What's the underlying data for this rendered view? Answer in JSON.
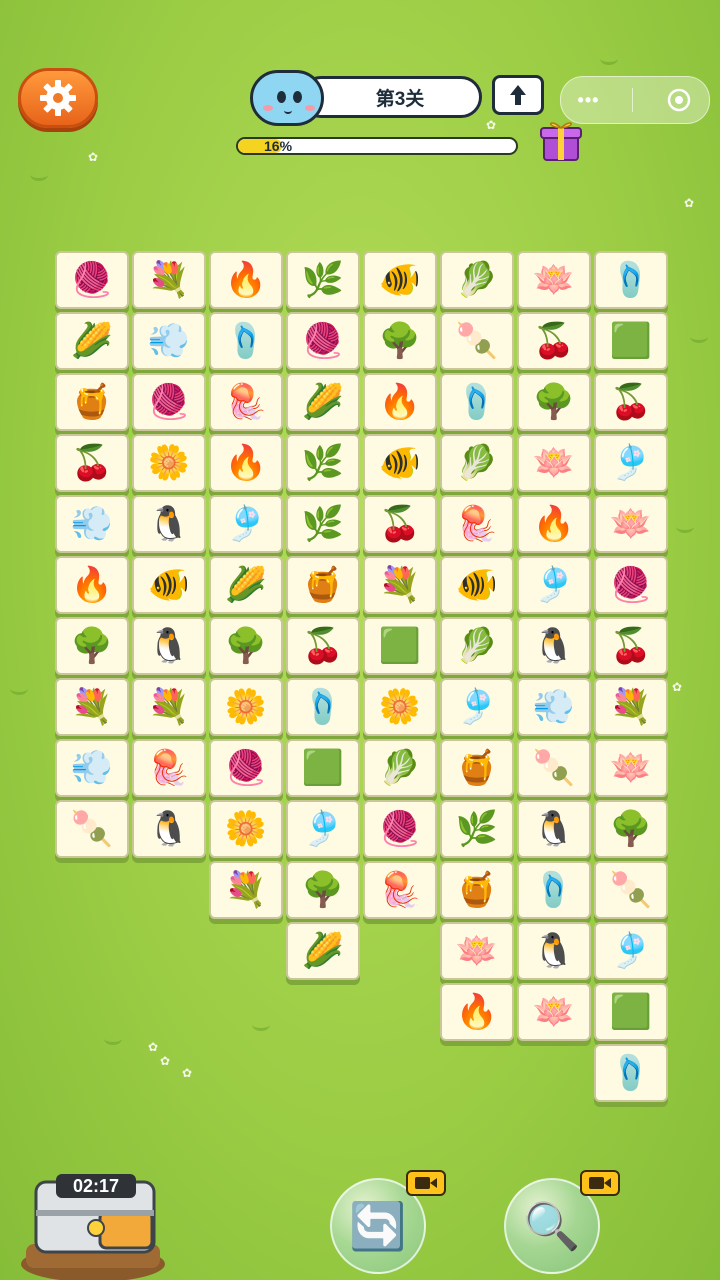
{
  "header": {
    "level_label": "第3关",
    "progress_label": "16%",
    "progress_value": 0.16,
    "menu_dots": "•••"
  },
  "timer": {
    "value": "02:17"
  },
  "colors": {
    "tile_bg": "#fffbe3",
    "tile_shadow": "#7fa83a",
    "settings_orange": "#f07a28",
    "progress_yellow": "#f5d321"
  },
  "board": {
    "tiles": [
      {
        "r": 0,
        "c": 0,
        "icon": "yarn-ball",
        "glyph": "🧶"
      },
      {
        "r": 0,
        "c": 1,
        "icon": "flower-pot",
        "glyph": "💐"
      },
      {
        "r": 0,
        "c": 2,
        "icon": "campfire",
        "glyph": "🔥"
      },
      {
        "r": 0,
        "c": 3,
        "icon": "monstera-leaf",
        "glyph": "🌿"
      },
      {
        "r": 0,
        "c": 4,
        "icon": "clownfish",
        "glyph": "🐠"
      },
      {
        "r": 0,
        "c": 5,
        "icon": "cabbage",
        "glyph": "🥬"
      },
      {
        "r": 0,
        "c": 6,
        "icon": "lotus",
        "glyph": "🪷"
      },
      {
        "r": 0,
        "c": 7,
        "icon": "flip-flops",
        "glyph": "🩴"
      },
      {
        "r": 1,
        "c": 0,
        "icon": "corn",
        "glyph": "🌽"
      },
      {
        "r": 1,
        "c": 1,
        "icon": "hair-dryer",
        "glyph": "💨"
      },
      {
        "r": 1,
        "c": 2,
        "icon": "flip-flops",
        "glyph": "🩴"
      },
      {
        "r": 1,
        "c": 3,
        "icon": "yarn-ball",
        "glyph": "🧶"
      },
      {
        "r": 1,
        "c": 4,
        "icon": "bonsai",
        "glyph": "🌳"
      },
      {
        "r": 1,
        "c": 5,
        "icon": "popsicle",
        "glyph": "🍡"
      },
      {
        "r": 1,
        "c": 6,
        "icon": "cherries",
        "glyph": "🍒"
      },
      {
        "r": 1,
        "c": 7,
        "icon": "towels",
        "glyph": "🟩"
      },
      {
        "r": 2,
        "c": 0,
        "icon": "honeycomb",
        "glyph": "🍯"
      },
      {
        "r": 2,
        "c": 1,
        "icon": "yarn-ball",
        "glyph": "🧶"
      },
      {
        "r": 2,
        "c": 2,
        "icon": "jellyfish",
        "glyph": "🪼"
      },
      {
        "r": 2,
        "c": 3,
        "icon": "corn",
        "glyph": "🌽"
      },
      {
        "r": 2,
        "c": 4,
        "icon": "campfire",
        "glyph": "🔥"
      },
      {
        "r": 2,
        "c": 5,
        "icon": "flip-flops",
        "glyph": "🩴"
      },
      {
        "r": 2,
        "c": 6,
        "icon": "bonsai",
        "glyph": "🌳"
      },
      {
        "r": 2,
        "c": 7,
        "icon": "cherries",
        "glyph": "🍒"
      },
      {
        "r": 3,
        "c": 0,
        "icon": "cherries",
        "glyph": "🍒"
      },
      {
        "r": 3,
        "c": 1,
        "icon": "yellow-flower",
        "glyph": "🌼"
      },
      {
        "r": 3,
        "c": 2,
        "icon": "campfire",
        "glyph": "🔥"
      },
      {
        "r": 3,
        "c": 3,
        "icon": "monstera-leaf",
        "glyph": "🌿"
      },
      {
        "r": 3,
        "c": 4,
        "icon": "clownfish",
        "glyph": "🐠"
      },
      {
        "r": 3,
        "c": 5,
        "icon": "cabbage",
        "glyph": "🥬"
      },
      {
        "r": 3,
        "c": 6,
        "icon": "lotus",
        "glyph": "🪷"
      },
      {
        "r": 3,
        "c": 7,
        "icon": "pinwheel",
        "glyph": "🎐"
      },
      {
        "r": 4,
        "c": 0,
        "icon": "hair-dryer",
        "glyph": "💨"
      },
      {
        "r": 4,
        "c": 1,
        "icon": "penguin",
        "glyph": "🐧"
      },
      {
        "r": 4,
        "c": 2,
        "icon": "pinwheel",
        "glyph": "🎐"
      },
      {
        "r": 4,
        "c": 3,
        "icon": "monstera-leaf",
        "glyph": "🌿"
      },
      {
        "r": 4,
        "c": 4,
        "icon": "cherries",
        "glyph": "🍒"
      },
      {
        "r": 4,
        "c": 5,
        "icon": "jellyfish",
        "glyph": "🪼"
      },
      {
        "r": 4,
        "c": 6,
        "icon": "campfire",
        "glyph": "🔥"
      },
      {
        "r": 4,
        "c": 7,
        "icon": "lotus",
        "glyph": "🪷"
      },
      {
        "r": 5,
        "c": 0,
        "icon": "campfire",
        "glyph": "🔥"
      },
      {
        "r": 5,
        "c": 1,
        "icon": "clownfish",
        "glyph": "🐠"
      },
      {
        "r": 5,
        "c": 2,
        "icon": "corn",
        "glyph": "🌽"
      },
      {
        "r": 5,
        "c": 3,
        "icon": "honeycomb",
        "glyph": "🍯"
      },
      {
        "r": 5,
        "c": 4,
        "icon": "flower-pot",
        "glyph": "💐"
      },
      {
        "r": 5,
        "c": 5,
        "icon": "clownfish",
        "glyph": "🐠"
      },
      {
        "r": 5,
        "c": 6,
        "icon": "pinwheel",
        "glyph": "🎐"
      },
      {
        "r": 5,
        "c": 7,
        "icon": "yarn-ball",
        "glyph": "🧶"
      },
      {
        "r": 6,
        "c": 0,
        "icon": "bonsai",
        "glyph": "🌳"
      },
      {
        "r": 6,
        "c": 1,
        "icon": "penguin",
        "glyph": "🐧"
      },
      {
        "r": 6,
        "c": 2,
        "icon": "bonsai",
        "glyph": "🌳"
      },
      {
        "r": 6,
        "c": 3,
        "icon": "cherries",
        "glyph": "🍒"
      },
      {
        "r": 6,
        "c": 4,
        "icon": "towels",
        "glyph": "🟩"
      },
      {
        "r": 6,
        "c": 5,
        "icon": "cabbage",
        "glyph": "🥬"
      },
      {
        "r": 6,
        "c": 6,
        "icon": "penguin",
        "glyph": "🐧"
      },
      {
        "r": 6,
        "c": 7,
        "icon": "cherries",
        "glyph": "🍒"
      },
      {
        "r": 7,
        "c": 0,
        "icon": "flower-pot",
        "glyph": "💐"
      },
      {
        "r": 7,
        "c": 1,
        "icon": "flower-pot",
        "glyph": "💐"
      },
      {
        "r": 7,
        "c": 2,
        "icon": "yellow-flower",
        "glyph": "🌼"
      },
      {
        "r": 7,
        "c": 3,
        "icon": "flip-flops",
        "glyph": "🩴"
      },
      {
        "r": 7,
        "c": 4,
        "icon": "yellow-flower",
        "glyph": "🌼"
      },
      {
        "r": 7,
        "c": 5,
        "icon": "pinwheel",
        "glyph": "🎐"
      },
      {
        "r": 7,
        "c": 6,
        "icon": "hair-dryer",
        "glyph": "💨"
      },
      {
        "r": 7,
        "c": 7,
        "icon": "flower-pot",
        "glyph": "💐"
      },
      {
        "r": 8,
        "c": 0,
        "icon": "hair-dryer",
        "glyph": "💨"
      },
      {
        "r": 8,
        "c": 1,
        "icon": "jellyfish",
        "glyph": "🪼"
      },
      {
        "r": 8,
        "c": 2,
        "icon": "yarn-ball",
        "glyph": "🧶"
      },
      {
        "r": 8,
        "c": 3,
        "icon": "towels",
        "glyph": "🟩"
      },
      {
        "r": 8,
        "c": 4,
        "icon": "cabbage",
        "glyph": "🥬"
      },
      {
        "r": 8,
        "c": 5,
        "icon": "honeycomb",
        "glyph": "🍯"
      },
      {
        "r": 8,
        "c": 6,
        "icon": "popsicle",
        "glyph": "🍡"
      },
      {
        "r": 8,
        "c": 7,
        "icon": "lotus",
        "glyph": "🪷"
      },
      {
        "r": 9,
        "c": 0,
        "icon": "popsicle",
        "glyph": "🍡"
      },
      {
        "r": 9,
        "c": 1,
        "icon": "penguin",
        "glyph": "🐧"
      },
      {
        "r": 9,
        "c": 2,
        "icon": "yellow-flower",
        "glyph": "🌼"
      },
      {
        "r": 9,
        "c": 3,
        "icon": "pinwheel",
        "glyph": "🎐"
      },
      {
        "r": 9,
        "c": 4,
        "icon": "yarn-ball",
        "glyph": "🧶"
      },
      {
        "r": 9,
        "c": 5,
        "icon": "monstera-leaf",
        "glyph": "🌿"
      },
      {
        "r": 9,
        "c": 6,
        "icon": "penguin",
        "glyph": "🐧"
      },
      {
        "r": 9,
        "c": 7,
        "icon": "bonsai",
        "glyph": "🌳"
      },
      {
        "r": 10,
        "c": 2,
        "icon": "flower-pot",
        "glyph": "💐"
      },
      {
        "r": 10,
        "c": 3,
        "icon": "bonsai",
        "glyph": "🌳"
      },
      {
        "r": 10,
        "c": 4,
        "icon": "jellyfish",
        "glyph": "🪼"
      },
      {
        "r": 10,
        "c": 5,
        "icon": "honeycomb",
        "glyph": "🍯"
      },
      {
        "r": 10,
        "c": 6,
        "icon": "flip-flops",
        "glyph": "🩴"
      },
      {
        "r": 10,
        "c": 7,
        "icon": "popsicle",
        "glyph": "🍡"
      },
      {
        "r": 11,
        "c": 3,
        "icon": "corn",
        "glyph": "🌽"
      },
      {
        "r": 11,
        "c": 5,
        "icon": "lotus",
        "glyph": "🪷"
      },
      {
        "r": 11,
        "c": 6,
        "icon": "penguin",
        "glyph": "🐧"
      },
      {
        "r": 11,
        "c": 7,
        "icon": "pinwheel",
        "glyph": "🎐"
      },
      {
        "r": 12,
        "c": 5,
        "icon": "campfire",
        "glyph": "🔥"
      },
      {
        "r": 12,
        "c": 6,
        "icon": "lotus",
        "glyph": "🪷"
      },
      {
        "r": 12,
        "c": 7,
        "icon": "towels",
        "glyph": "🟩"
      },
      {
        "r": 13,
        "c": 7,
        "icon": "flip-flops",
        "glyph": "🩴"
      }
    ]
  },
  "tools": [
    {
      "name": "shuffle-button",
      "icon": "shuffle-icon",
      "glyph": "🔄"
    },
    {
      "name": "hint-button",
      "icon": "magnifier-icon",
      "glyph": "🔍"
    }
  ]
}
